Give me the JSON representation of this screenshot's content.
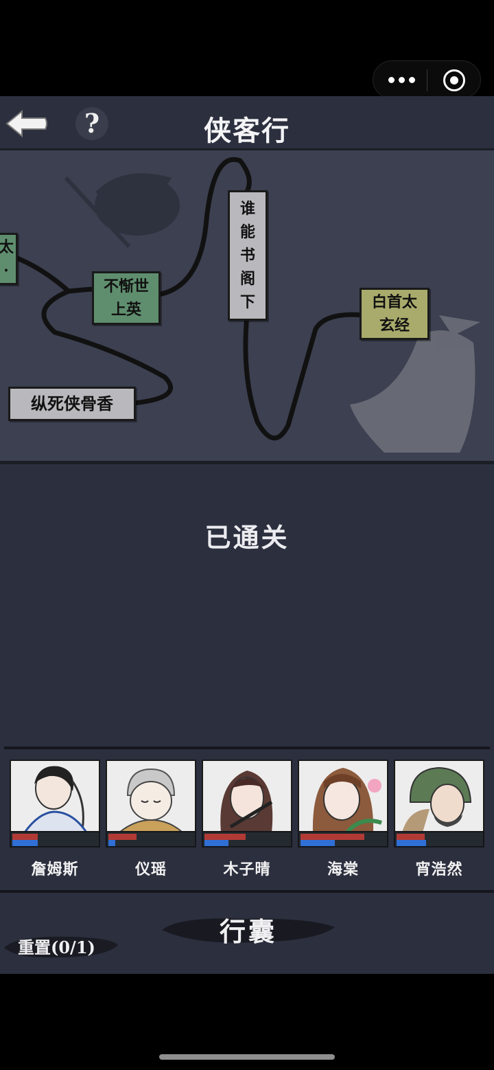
{
  "title": "侠客行",
  "status_text": "已通关",
  "map_nodes": [
    {
      "id": "edge",
      "label": "太\n·",
      "color": "green"
    },
    {
      "id": "buxie",
      "label": "不惭世\n上英",
      "color": "green"
    },
    {
      "id": "shuineng",
      "label": "谁\n能\n书\n阁\n下",
      "color": "gray"
    },
    {
      "id": "baishou",
      "label": "白首太\n玄经",
      "color": "olive"
    },
    {
      "id": "zongsi",
      "label": "纵死侠骨香",
      "color": "gray"
    }
  ],
  "party": [
    {
      "name": "詹姆斯",
      "hp": 0.3,
      "mp": 0.3
    },
    {
      "name": "仪瑶",
      "hp": 0.33,
      "mp": 0.08
    },
    {
      "name": "木子晴",
      "hp": 0.48,
      "mp": 0.28
    },
    {
      "name": "海棠",
      "hp": 0.75,
      "mp": 0.4
    },
    {
      "name": "宵浩然",
      "hp": 0.33,
      "mp": 0.35
    }
  ],
  "bag_label": "行囊",
  "reset_label": "重置(0/1)",
  "colors": {
    "panel": "#2b2f3e",
    "map_bg": "#3c4050",
    "hp": "#b23a35",
    "mp": "#2f6fd6"
  },
  "icons": {
    "back": "back-arrow-icon",
    "help": "question-mark-icon",
    "menu": "more-dots-icon",
    "close": "record-circle-icon"
  }
}
